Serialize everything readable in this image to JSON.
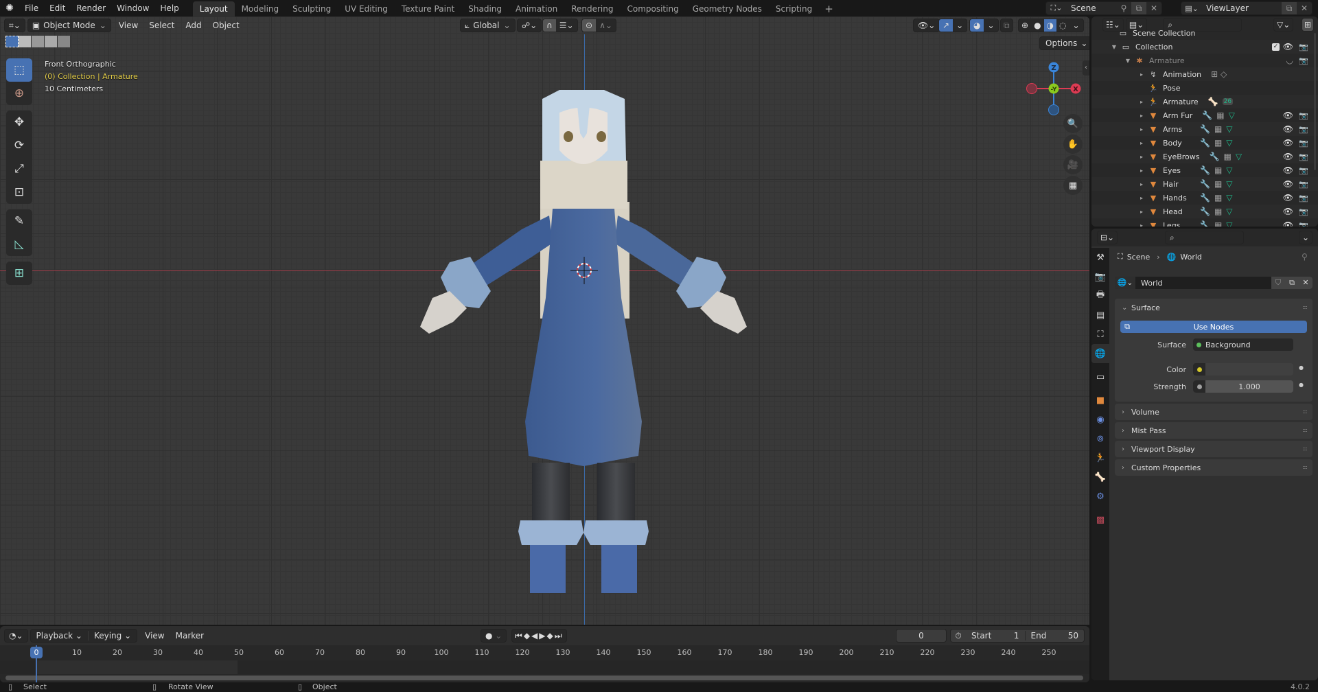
{
  "topbar": {
    "menus": [
      "File",
      "Edit",
      "Render",
      "Window",
      "Help"
    ],
    "workspaces": [
      "Layout",
      "Modeling",
      "Sculpting",
      "UV Editing",
      "Texture Paint",
      "Shading",
      "Animation",
      "Rendering",
      "Compositing",
      "Geometry Nodes",
      "Scripting"
    ],
    "active_workspace": "Layout",
    "add_workspace": "+",
    "scene_name": "Scene",
    "view_layer": "ViewLayer"
  },
  "viewport": {
    "mode": "Object Mode",
    "menus": [
      "View",
      "Select",
      "Add",
      "Object"
    ],
    "transform_orientation": "Global",
    "options_label": "Options",
    "overlay": {
      "view_name": "Front Orthographic",
      "context": "(0) Collection | Armature",
      "scale": "10 Centimeters"
    },
    "gizmo": {
      "z": "Z",
      "y": "-Y",
      "x": "X"
    },
    "colors": {
      "x_axis": "#dd3b53",
      "y_axis": "#8bcb1e",
      "z_axis": "#3a85d9",
      "selection": "#4772b3"
    }
  },
  "toolbar": {
    "tools": [
      "select-box",
      "cursor",
      "move",
      "rotate",
      "scale",
      "transform",
      "annotate",
      "measure",
      "add-cube"
    ]
  },
  "timeline": {
    "menus": [
      "Playback",
      "Keying",
      "View",
      "Marker"
    ],
    "current_frame": "0",
    "start_label": "Start",
    "start_value": "1",
    "end_label": "End",
    "end_value": "50",
    "ruler_ticks": [
      "0",
      "10",
      "20",
      "30",
      "40",
      "50",
      "60",
      "70",
      "80",
      "90",
      "100",
      "110",
      "120",
      "130",
      "140",
      "150",
      "160",
      "170",
      "180",
      "190",
      "200",
      "210",
      "220",
      "230",
      "240",
      "250"
    ]
  },
  "statusbar": {
    "hints": [
      "Select",
      "Rotate View",
      "Object"
    ],
    "version": "4.0.2"
  },
  "outliner": {
    "search_placeholder": "",
    "root": "Scene Collection",
    "collection": "Collection",
    "armature_object": "Armature",
    "armature_children": [
      "Animation",
      "Pose",
      "Armature"
    ],
    "bone_count": "26",
    "meshes": [
      "Arm Fur",
      "Arms",
      "Body",
      "EyeBrows",
      "Eyes",
      "Hair",
      "Hands",
      "Head",
      "Legs"
    ]
  },
  "properties": {
    "breadcrumb": [
      "Scene",
      "World"
    ],
    "world_name": "World",
    "surface_panel": "Surface",
    "use_nodes_label": "Use Nodes",
    "surface_label": "Surface",
    "surface_value": "Background",
    "color_label": "Color",
    "strength_label": "Strength",
    "strength_value": "1.000",
    "collapsed_panels": [
      "Volume",
      "Mist Pass",
      "Viewport Display",
      "Custom Properties"
    ],
    "tabs": [
      "tool",
      "render",
      "output",
      "view-layer",
      "scene",
      "world",
      "collection",
      "object",
      "physics",
      "constraints",
      "object-data",
      "bone",
      "bone-constraints",
      "texture"
    ],
    "active_tab": "world"
  }
}
